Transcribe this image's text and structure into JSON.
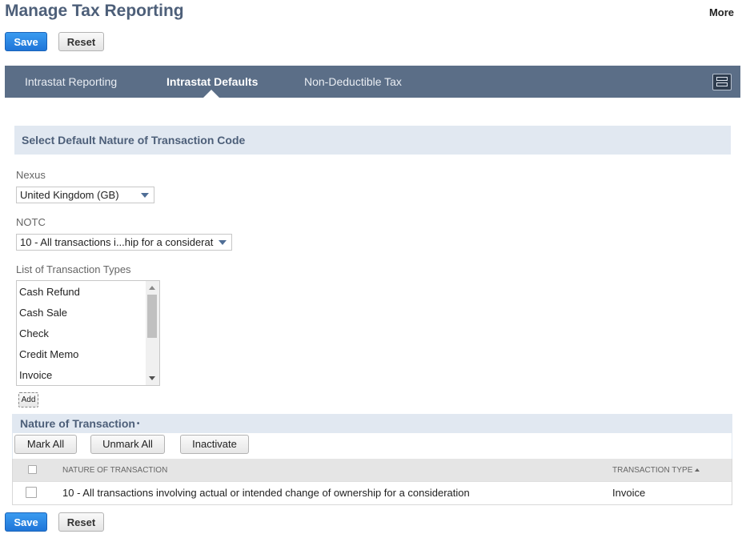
{
  "page": {
    "title": "Manage Tax Reporting",
    "more_label": "More"
  },
  "top_buttons": {
    "save_label": "Save",
    "reset_label": "Reset"
  },
  "tabs": [
    {
      "label": "Intrastat Reporting",
      "active": false
    },
    {
      "label": "Intrastat Defaults",
      "active": true
    },
    {
      "label": "Non-Deductible Tax",
      "active": false
    }
  ],
  "section": {
    "title": "Select Default Nature of Transaction Code"
  },
  "fields": {
    "nexus": {
      "label": "Nexus",
      "value": "United Kingdom (GB)"
    },
    "notc": {
      "label": "NOTC",
      "value": "10 - All transactions i...hip for a considerat"
    },
    "transaction_types": {
      "label": "List of Transaction Types",
      "items": [
        "Cash Refund",
        "Cash Sale",
        "Check",
        "Credit Memo",
        "Invoice"
      ],
      "add_label": "Add"
    }
  },
  "nature_of_transaction": {
    "title": "Nature of Transaction",
    "required_marker": "•",
    "buttons": {
      "mark_all": "Mark All",
      "unmark_all": "Unmark All",
      "inactivate": "Inactivate"
    },
    "columns": {
      "nature": "NATURE OF TRANSACTION",
      "type": "TRANSACTION TYPE"
    },
    "rows": [
      {
        "checked": false,
        "nature": "10 - All transactions involving actual or intended change of ownership for a consideration",
        "type": "Invoice"
      }
    ]
  },
  "bottom_buttons": {
    "save_label": "Save",
    "reset_label": "Reset"
  },
  "colors": {
    "accent": "#1f75d8",
    "tab_bar": "#5b6e87",
    "section_bg": "#e1e8f1",
    "heading": "#4d5f79"
  }
}
